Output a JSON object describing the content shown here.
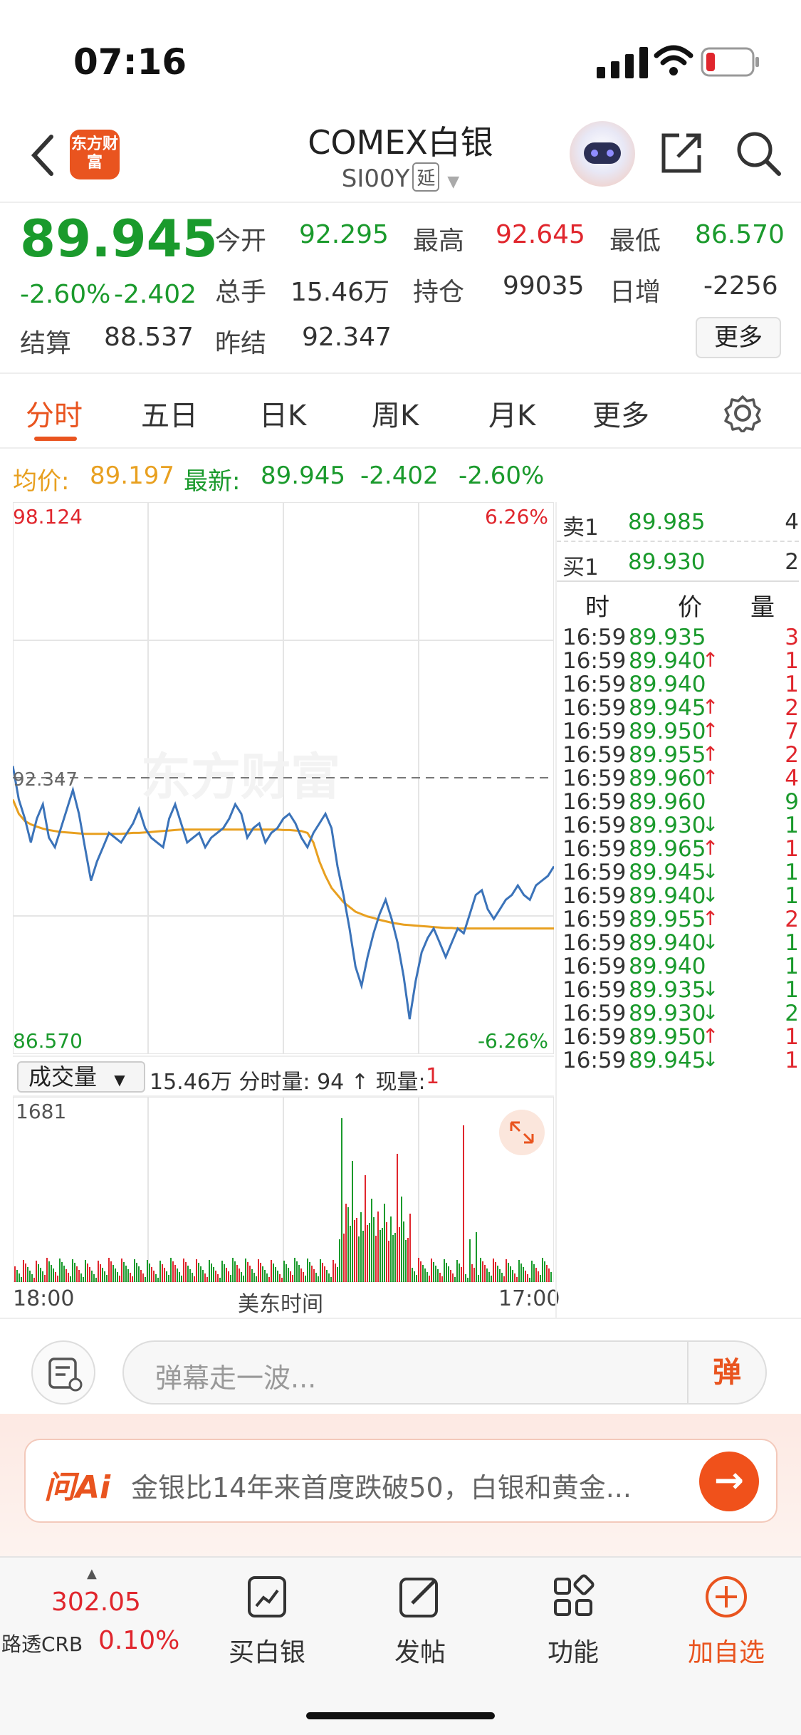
{
  "status": {
    "time": "07:16"
  },
  "header": {
    "logo_text": "东方财富",
    "title": "COMEX白银",
    "code": "SI00Y",
    "delay_tag": "延"
  },
  "quote": {
    "price": "89.945",
    "change_pct": "-2.60%",
    "change": "-2.402",
    "open_label": "今开",
    "open": "92.295",
    "high_label": "最高",
    "high": "92.645",
    "low_label": "最低",
    "low": "86.570",
    "volume_label": "总手",
    "volume": "15.46万",
    "oi_label": "持仓",
    "oi": "99035",
    "daily_label": "日增",
    "daily": "-2256",
    "settle_label": "结算",
    "settle": "88.537",
    "prev_label": "昨结",
    "prev": "92.347",
    "more": "更多"
  },
  "tabs": [
    "分时",
    "五日",
    "日K",
    "周K",
    "月K",
    "更多"
  ],
  "avg": {
    "avg_label": "均价:",
    "avg_value": "89.197",
    "latest_label": "最新:",
    "latest_value": "89.945",
    "latest_change": "-2.402",
    "latest_pct": "-2.60%"
  },
  "chart_data": {
    "type": "line",
    "y_max_label": "98.124",
    "y_min_label": "86.570",
    "pct_max_label": "6.26%",
    "pct_min_label": "-6.26%",
    "ref_label": "92.347",
    "ylim": [
      86.57,
      98.124
    ],
    "reference": 92.347,
    "watermark": "东方财富",
    "price_series": [
      92.6,
      91.9,
      91.5,
      91.0,
      91.5,
      91.8,
      91.1,
      90.9,
      91.3,
      91.7,
      92.1,
      91.6,
      90.9,
      90.2,
      90.6,
      90.9,
      91.2,
      91.1,
      91.0,
      91.2,
      91.4,
      91.7,
      91.3,
      91.1,
      91.0,
      90.9,
      91.5,
      91.8,
      91.4,
      91.0,
      91.1,
      91.2,
      90.9,
      91.1,
      91.2,
      91.3,
      91.5,
      91.8,
      91.6,
      91.1,
      91.3,
      91.4,
      91.0,
      91.2,
      91.3,
      91.5,
      91.6,
      91.4,
      91.1,
      90.9,
      91.2,
      91.4,
      91.6,
      91.3,
      90.5,
      89.9,
      89.2,
      88.4,
      88.0,
      88.6,
      89.1,
      89.5,
      89.8,
      89.4,
      88.9,
      88.2,
      87.3,
      88.1,
      88.7,
      89.0,
      89.2,
      88.9,
      88.6,
      88.9,
      89.2,
      89.1,
      89.5,
      89.9,
      90.0,
      89.6,
      89.4,
      89.6,
      89.8,
      89.9,
      90.1,
      89.9,
      89.8,
      90.1,
      90.2,
      90.3,
      90.5
    ],
    "avg_series": [
      91.9,
      91.6,
      91.45,
      91.38,
      91.33,
      91.29,
      91.26,
      91.24,
      91.22,
      91.21,
      91.2,
      91.19,
      91.18,
      91.18,
      91.18,
      91.18,
      91.18,
      91.18,
      91.18,
      91.19,
      91.2,
      91.2,
      91.21,
      91.22,
      91.23,
      91.24,
      91.25,
      91.26,
      91.27,
      91.27,
      91.27,
      91.27,
      91.27,
      91.27,
      91.27,
      91.27,
      91.27,
      91.27,
      91.27,
      91.27,
      91.27,
      91.27,
      91.27,
      91.27,
      91.27,
      91.26,
      91.26,
      91.25,
      91.24,
      91.2,
      91.0,
      90.6,
      90.3,
      90.05,
      89.9,
      89.75,
      89.65,
      89.55,
      89.5,
      89.45,
      89.42,
      89.38,
      89.35,
      89.32,
      89.3,
      89.28,
      89.27,
      89.26,
      89.25,
      89.24,
      89.23,
      89.22,
      89.21,
      89.21,
      89.2,
      89.2,
      89.2,
      89.2,
      89.2,
      89.2,
      89.2,
      89.2,
      89.2,
      89.2,
      89.2,
      89.2,
      89.2,
      89.2,
      89.2,
      89.2,
      89.2
    ],
    "x_start": "18:00",
    "x_mid": "美东时间",
    "x_end": "17:00",
    "volume_max_label": "1681"
  },
  "volume_bar": {
    "select": "成交量",
    "summary_prefix": "15.46万 分时量: 94 ↑ 现量: ",
    "current": "1"
  },
  "orderbook": {
    "sell_label": "卖1",
    "sell_price": "89.985",
    "sell_vol": "4",
    "buy_label": "买1",
    "buy_price": "89.930",
    "buy_vol": "2",
    "col_time": "时",
    "col_price": "价",
    "col_vol": "量"
  },
  "ticks": [
    {
      "t": "16:59",
      "p": "89.935",
      "a": "",
      "v": "3",
      "c": "red"
    },
    {
      "t": "16:59",
      "p": "89.940",
      "a": "↑",
      "v": "1",
      "c": "red"
    },
    {
      "t": "16:59",
      "p": "89.940",
      "a": "",
      "v": "1",
      "c": "red"
    },
    {
      "t": "16:59",
      "p": "89.945",
      "a": "↑",
      "v": "2",
      "c": "red"
    },
    {
      "t": "16:59",
      "p": "89.950",
      "a": "↑",
      "v": "7",
      "c": "red"
    },
    {
      "t": "16:59",
      "p": "89.955",
      "a": "↑",
      "v": "2",
      "c": "red"
    },
    {
      "t": "16:59",
      "p": "89.960",
      "a": "↑",
      "v": "4",
      "c": "red"
    },
    {
      "t": "16:59",
      "p": "89.960",
      "a": "",
      "v": "9",
      "c": "green"
    },
    {
      "t": "16:59",
      "p": "89.930",
      "a": "↓",
      "v": "1",
      "c": "green"
    },
    {
      "t": "16:59",
      "p": "89.965",
      "a": "↑",
      "v": "1",
      "c": "red"
    },
    {
      "t": "16:59",
      "p": "89.945",
      "a": "↓",
      "v": "1",
      "c": "green"
    },
    {
      "t": "16:59",
      "p": "89.940",
      "a": "↓",
      "v": "1",
      "c": "green"
    },
    {
      "t": "16:59",
      "p": "89.955",
      "a": "↑",
      "v": "2",
      "c": "red"
    },
    {
      "t": "16:59",
      "p": "89.940",
      "a": "↓",
      "v": "1",
      "c": "green"
    },
    {
      "t": "16:59",
      "p": "89.940",
      "a": "",
      "v": "1",
      "c": "green"
    },
    {
      "t": "16:59",
      "p": "89.935",
      "a": "↓",
      "v": "1",
      "c": "green"
    },
    {
      "t": "16:59",
      "p": "89.930",
      "a": "↓",
      "v": "2",
      "c": "green"
    },
    {
      "t": "16:59",
      "p": "89.950",
      "a": "↑",
      "v": "1",
      "c": "red"
    },
    {
      "t": "16:59",
      "p": "89.945",
      "a": "↓",
      "v": "1",
      "c": "red"
    }
  ],
  "comment": {
    "placeholder": "弹幕走一波...",
    "dan": "弹"
  },
  "ai": {
    "logo": "问Ai",
    "text": "金银比14年来首度跌破50，白银和黄金..."
  },
  "bottom": {
    "index_value": "302.05",
    "index_name": "路透CRB",
    "index_pct": "0.10%",
    "nav": [
      "买白银",
      "发帖",
      "功能",
      "加自选"
    ]
  },
  "colors": {
    "accent": "#e9541f",
    "up": "#e0262d",
    "down": "#1a9a2c",
    "price_line": "#3b73b9",
    "avg_line": "#e8a020"
  }
}
